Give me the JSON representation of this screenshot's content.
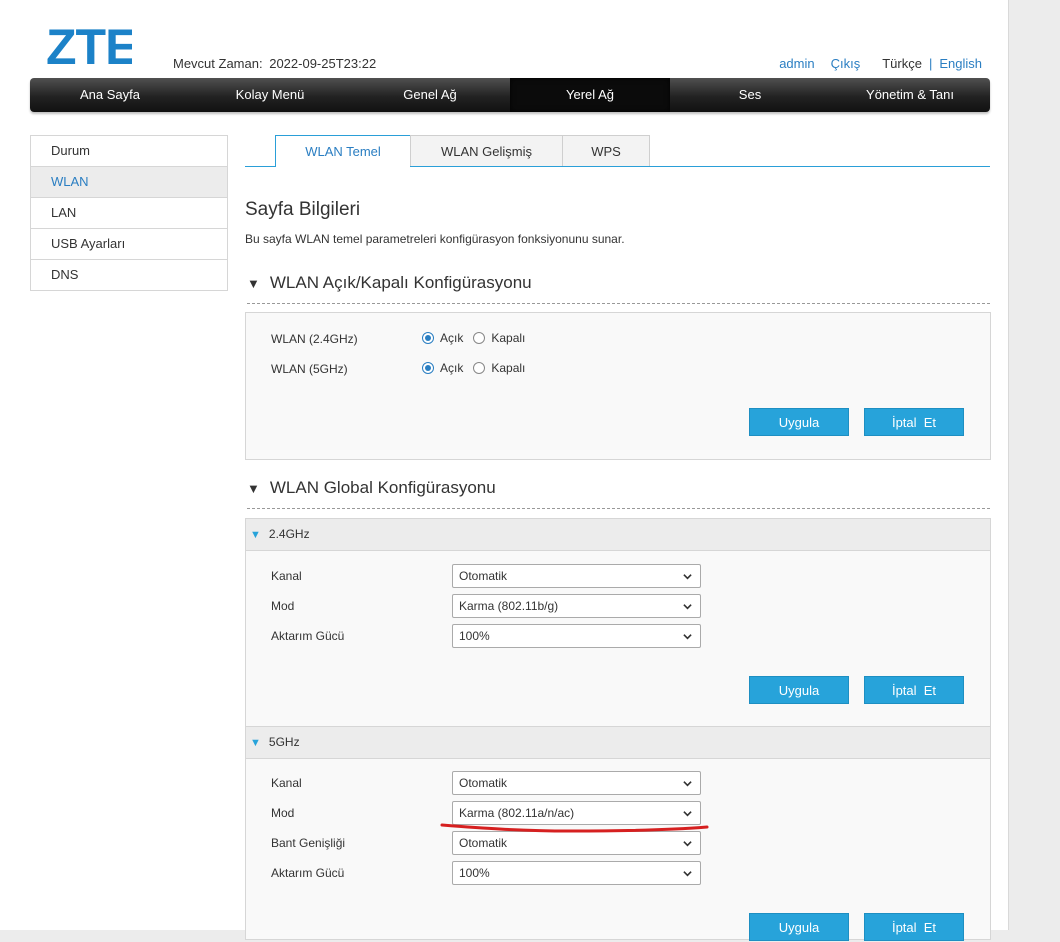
{
  "header": {
    "logo": "ZTE",
    "time_label": "Mevcut Zaman:",
    "time_value": "2022-09-25T23:22",
    "user": "admin",
    "logout": "Çıkış",
    "lang_tr": "Türkçe",
    "lang_sep": "|",
    "lang_en": "English"
  },
  "nav": [
    "Ana Sayfa",
    "Kolay Menü",
    "Genel Ağ",
    "Yerel Ağ",
    "Ses",
    "Yönetim & Tanı"
  ],
  "sidebar": [
    "Durum",
    "WLAN",
    "LAN",
    "USB Ayarları",
    "DNS"
  ],
  "tabs": [
    "WLAN Temel",
    "WLAN Gelişmiş",
    "WPS"
  ],
  "page": {
    "title": "Sayfa Bilgileri",
    "desc": "Bu sayfa WLAN temel parametreleri konfigürasyon fonksiyonunu sunar."
  },
  "onoff": {
    "title": "WLAN Açık/Kapalı Konfigürasyonu",
    "rows": [
      {
        "label": "WLAN (2.4GHz)",
        "on": "Açık",
        "off": "Kapalı"
      },
      {
        "label": "WLAN (5GHz)",
        "on": "Açık",
        "off": "Kapalı"
      }
    ],
    "apply": "Uygula",
    "cancel": "İptal  Et"
  },
  "global": {
    "title": "WLAN Global Konfigürasyonu",
    "band24": {
      "title": "2.4GHz",
      "kanal_label": "Kanal",
      "kanal_value": "Otomatik",
      "mod_label": "Mod",
      "mod_value": "Karma (802.11b/g)",
      "guc_label": "Aktarım Gücü",
      "guc_value": "100%",
      "apply": "Uygula",
      "cancel": "İptal  Et"
    },
    "band5": {
      "title": "5GHz",
      "kanal_label": "Kanal",
      "kanal_value": "Otomatik",
      "mod_label": "Mod",
      "mod_value": "Karma (802.11a/n/ac)",
      "bant_label": "Bant Genişliği",
      "bant_value": "Otomatik",
      "guc_label": "Aktarım Gücü",
      "guc_value": "100%",
      "apply": "Uygula",
      "cancel": "İptal  Et"
    }
  },
  "colors": {
    "accent": "#27a3da",
    "link": "#2a7ec2",
    "annotation": "#d62020"
  }
}
